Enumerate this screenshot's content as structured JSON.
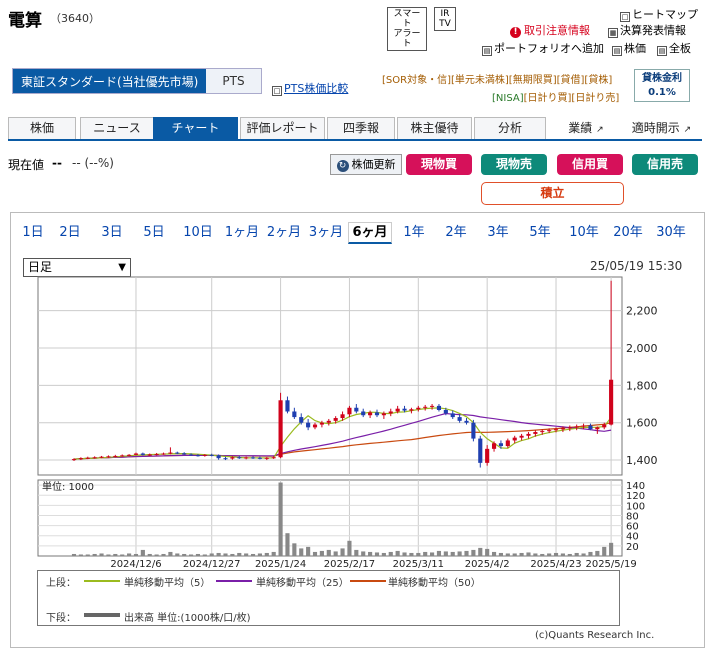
{
  "header": {
    "company": "電算",
    "code": "（3640）",
    "alert_button": "スマート\nアラート",
    "ir_button": "IR\nTV",
    "links": {
      "heatmap": "ヒートマップ",
      "torihiki": "取引注意情報",
      "kessan": "決算発表情報",
      "portfolio": "ポートフォリオへ追加",
      "kabuka": "株価",
      "zenban": "全板"
    }
  },
  "market": {
    "selected": "東証スタンダード(当社優先市場)",
    "other": "PTS",
    "pts_compare": "PTS株価比較"
  },
  "badges_row1": [
    "[SOR対象・信]",
    "[単元未満株]",
    "[無期限買]",
    "[貸借]",
    "[貸株]"
  ],
  "badges_row2": [
    "[NISA]",
    "[日計り買]",
    "[日計り売]"
  ],
  "kashi": {
    "label": "貸株金利",
    "value": "0.1%"
  },
  "tabs": [
    "株価",
    "ニュース",
    "チャート",
    "評価レポート",
    "四季報",
    "株主優待",
    "分析",
    "業績",
    "適時開示"
  ],
  "price": {
    "label": "現在値",
    "value": "--",
    "change": "-- (--%)",
    "refresh": "株価更新",
    "buy_spot": "現物買",
    "sell_spot": "現物売",
    "buy_margin": "信用買",
    "sell_margin": "信用売",
    "tsumitate": "積立"
  },
  "periods": [
    "1日",
    "2日",
    "3日",
    "5日",
    "10日",
    "1ヶ月",
    "2ヶ月",
    "3ヶ月",
    "6ヶ月",
    "1年",
    "2年",
    "3年",
    "5年",
    "10年",
    "20年",
    "30年"
  ],
  "period_selected": "6ヶ月",
  "interval": "日足",
  "timestamp": "25/05/19 15:30",
  "legend": {
    "upper_label": "上段：",
    "ma5": "単純移動平均（5）",
    "ma25": "単純移動平均（25）",
    "ma50": "単純移動平均（50）",
    "lower_label": "下段：",
    "volume": "出来高 単位:(1000株/口/枚)"
  },
  "copyright": "(c)Quants Research Inc.",
  "colors": {
    "up": "#d0021b",
    "down": "#1f3fb0",
    "ma5": "#9bbb1f",
    "ma25": "#7a1fa8",
    "ma50": "#c94a10",
    "volume": "#888888",
    "brand": "#0a5aa4"
  },
  "chart_data": {
    "type": "candlestick",
    "unit_label": "単位: 1000",
    "price_axis": {
      "ticks": [
        1400,
        1600,
        1800,
        2000,
        2200
      ],
      "range": [
        1320,
        2380
      ]
    },
    "volume_axis": {
      "ticks": [
        20,
        40,
        60,
        80,
        100,
        120,
        140
      ],
      "range": [
        0,
        150
      ]
    },
    "x_labels": [
      "2024/12/6",
      "2024/12/27",
      "2025/1/24",
      "2025/2/17",
      "2025/3/11",
      "2025/4/2",
      "2025/4/23",
      "2025/5/19"
    ],
    "candles": [
      [
        1400,
        1410,
        1395,
        1405
      ],
      [
        1405,
        1415,
        1400,
        1410
      ],
      [
        1410,
        1418,
        1405,
        1412
      ],
      [
        1412,
        1420,
        1408,
        1415
      ],
      [
        1415,
        1422,
        1410,
        1418
      ],
      [
        1418,
        1425,
        1412,
        1420
      ],
      [
        1420,
        1428,
        1415,
        1422
      ],
      [
        1422,
        1430,
        1418,
        1425
      ],
      [
        1425,
        1432,
        1420,
        1428
      ],
      [
        1428,
        1440,
        1425,
        1435
      ],
      [
        1435,
        1440,
        1425,
        1428
      ],
      [
        1428,
        1435,
        1422,
        1430
      ],
      [
        1430,
        1438,
        1425,
        1432
      ],
      [
        1432,
        1440,
        1428,
        1435
      ],
      [
        1435,
        1468,
        1430,
        1440
      ],
      [
        1440,
        1445,
        1432,
        1436
      ],
      [
        1436,
        1442,
        1428,
        1430
      ],
      [
        1430,
        1436,
        1422,
        1426
      ],
      [
        1426,
        1432,
        1418,
        1424
      ],
      [
        1424,
        1432,
        1418,
        1428
      ],
      [
        1428,
        1434,
        1420,
        1425
      ],
      [
        1425,
        1430,
        1402,
        1410
      ],
      [
        1410,
        1418,
        1400,
        1408
      ],
      [
        1408,
        1420,
        1402,
        1415
      ],
      [
        1415,
        1422,
        1406,
        1410
      ],
      [
        1410,
        1418,
        1404,
        1414
      ],
      [
        1414,
        1420,
        1406,
        1412
      ],
      [
        1412,
        1418,
        1404,
        1408
      ],
      [
        1408,
        1416,
        1400,
        1412
      ],
      [
        1412,
        1420,
        1406,
        1415
      ],
      [
        1415,
        1760,
        1410,
        1720
      ],
      [
        1720,
        1740,
        1650,
        1660
      ],
      [
        1660,
        1680,
        1620,
        1630
      ],
      [
        1630,
        1650,
        1590,
        1600
      ],
      [
        1600,
        1620,
        1560,
        1575
      ],
      [
        1575,
        1600,
        1565,
        1590
      ],
      [
        1590,
        1610,
        1575,
        1600
      ],
      [
        1600,
        1620,
        1585,
        1610
      ],
      [
        1610,
        1635,
        1595,
        1625
      ],
      [
        1625,
        1660,
        1610,
        1645
      ],
      [
        1645,
        1690,
        1630,
        1680
      ],
      [
        1680,
        1700,
        1650,
        1660
      ],
      [
        1660,
        1675,
        1630,
        1640
      ],
      [
        1640,
        1665,
        1625,
        1655
      ],
      [
        1655,
        1670,
        1630,
        1640
      ],
      [
        1640,
        1660,
        1620,
        1650
      ],
      [
        1650,
        1675,
        1635,
        1660
      ],
      [
        1660,
        1690,
        1650,
        1675
      ],
      [
        1675,
        1690,
        1655,
        1665
      ],
      [
        1665,
        1680,
        1650,
        1672
      ],
      [
        1672,
        1690,
        1660,
        1680
      ],
      [
        1680,
        1695,
        1665,
        1685
      ],
      [
        1685,
        1700,
        1670,
        1690
      ],
      [
        1690,
        1700,
        1660,
        1668
      ],
      [
        1668,
        1680,
        1640,
        1650
      ],
      [
        1650,
        1665,
        1620,
        1630
      ],
      [
        1630,
        1645,
        1600,
        1610
      ],
      [
        1610,
        1625,
        1590,
        1600
      ],
      [
        1600,
        1615,
        1500,
        1515
      ],
      [
        1515,
        1530,
        1360,
        1385
      ],
      [
        1385,
        1480,
        1370,
        1460
      ],
      [
        1460,
        1500,
        1445,
        1490
      ],
      [
        1490,
        1505,
        1460,
        1475
      ],
      [
        1475,
        1515,
        1465,
        1505
      ],
      [
        1505,
        1530,
        1490,
        1520
      ],
      [
        1520,
        1540,
        1505,
        1530
      ],
      [
        1530,
        1550,
        1515,
        1540
      ],
      [
        1540,
        1560,
        1525,
        1550
      ],
      [
        1550,
        1565,
        1535,
        1555
      ],
      [
        1555,
        1570,
        1545,
        1560
      ],
      [
        1560,
        1575,
        1548,
        1565
      ],
      [
        1565,
        1580,
        1550,
        1570
      ],
      [
        1570,
        1585,
        1555,
        1575
      ],
      [
        1575,
        1590,
        1560,
        1580
      ],
      [
        1580,
        1595,
        1565,
        1585
      ],
      [
        1585,
        1595,
        1560,
        1565
      ],
      [
        1565,
        1580,
        1540,
        1575
      ],
      [
        1575,
        1600,
        1565,
        1590
      ],
      [
        1590,
        2360,
        1585,
        1830
      ]
    ],
    "volume": [
      4,
      3,
      3,
      4,
      5,
      3,
      4,
      3,
      5,
      4,
      12,
      4,
      3,
      4,
      8,
      5,
      4,
      3,
      4,
      3,
      5,
      6,
      5,
      4,
      6,
      5,
      4,
      5,
      6,
      8,
      145,
      45,
      25,
      15,
      18,
      8,
      10,
      12,
      9,
      15,
      30,
      12,
      9,
      8,
      7,
      6,
      8,
      10,
      7,
      6,
      6,
      8,
      7,
      10,
      9,
      8,
      9,
      10,
      12,
      16,
      14,
      8,
      6,
      5,
      5,
      6,
      7,
      5,
      4,
      5,
      6,
      5,
      4,
      6,
      5,
      8,
      10,
      18,
      26
    ]
  }
}
